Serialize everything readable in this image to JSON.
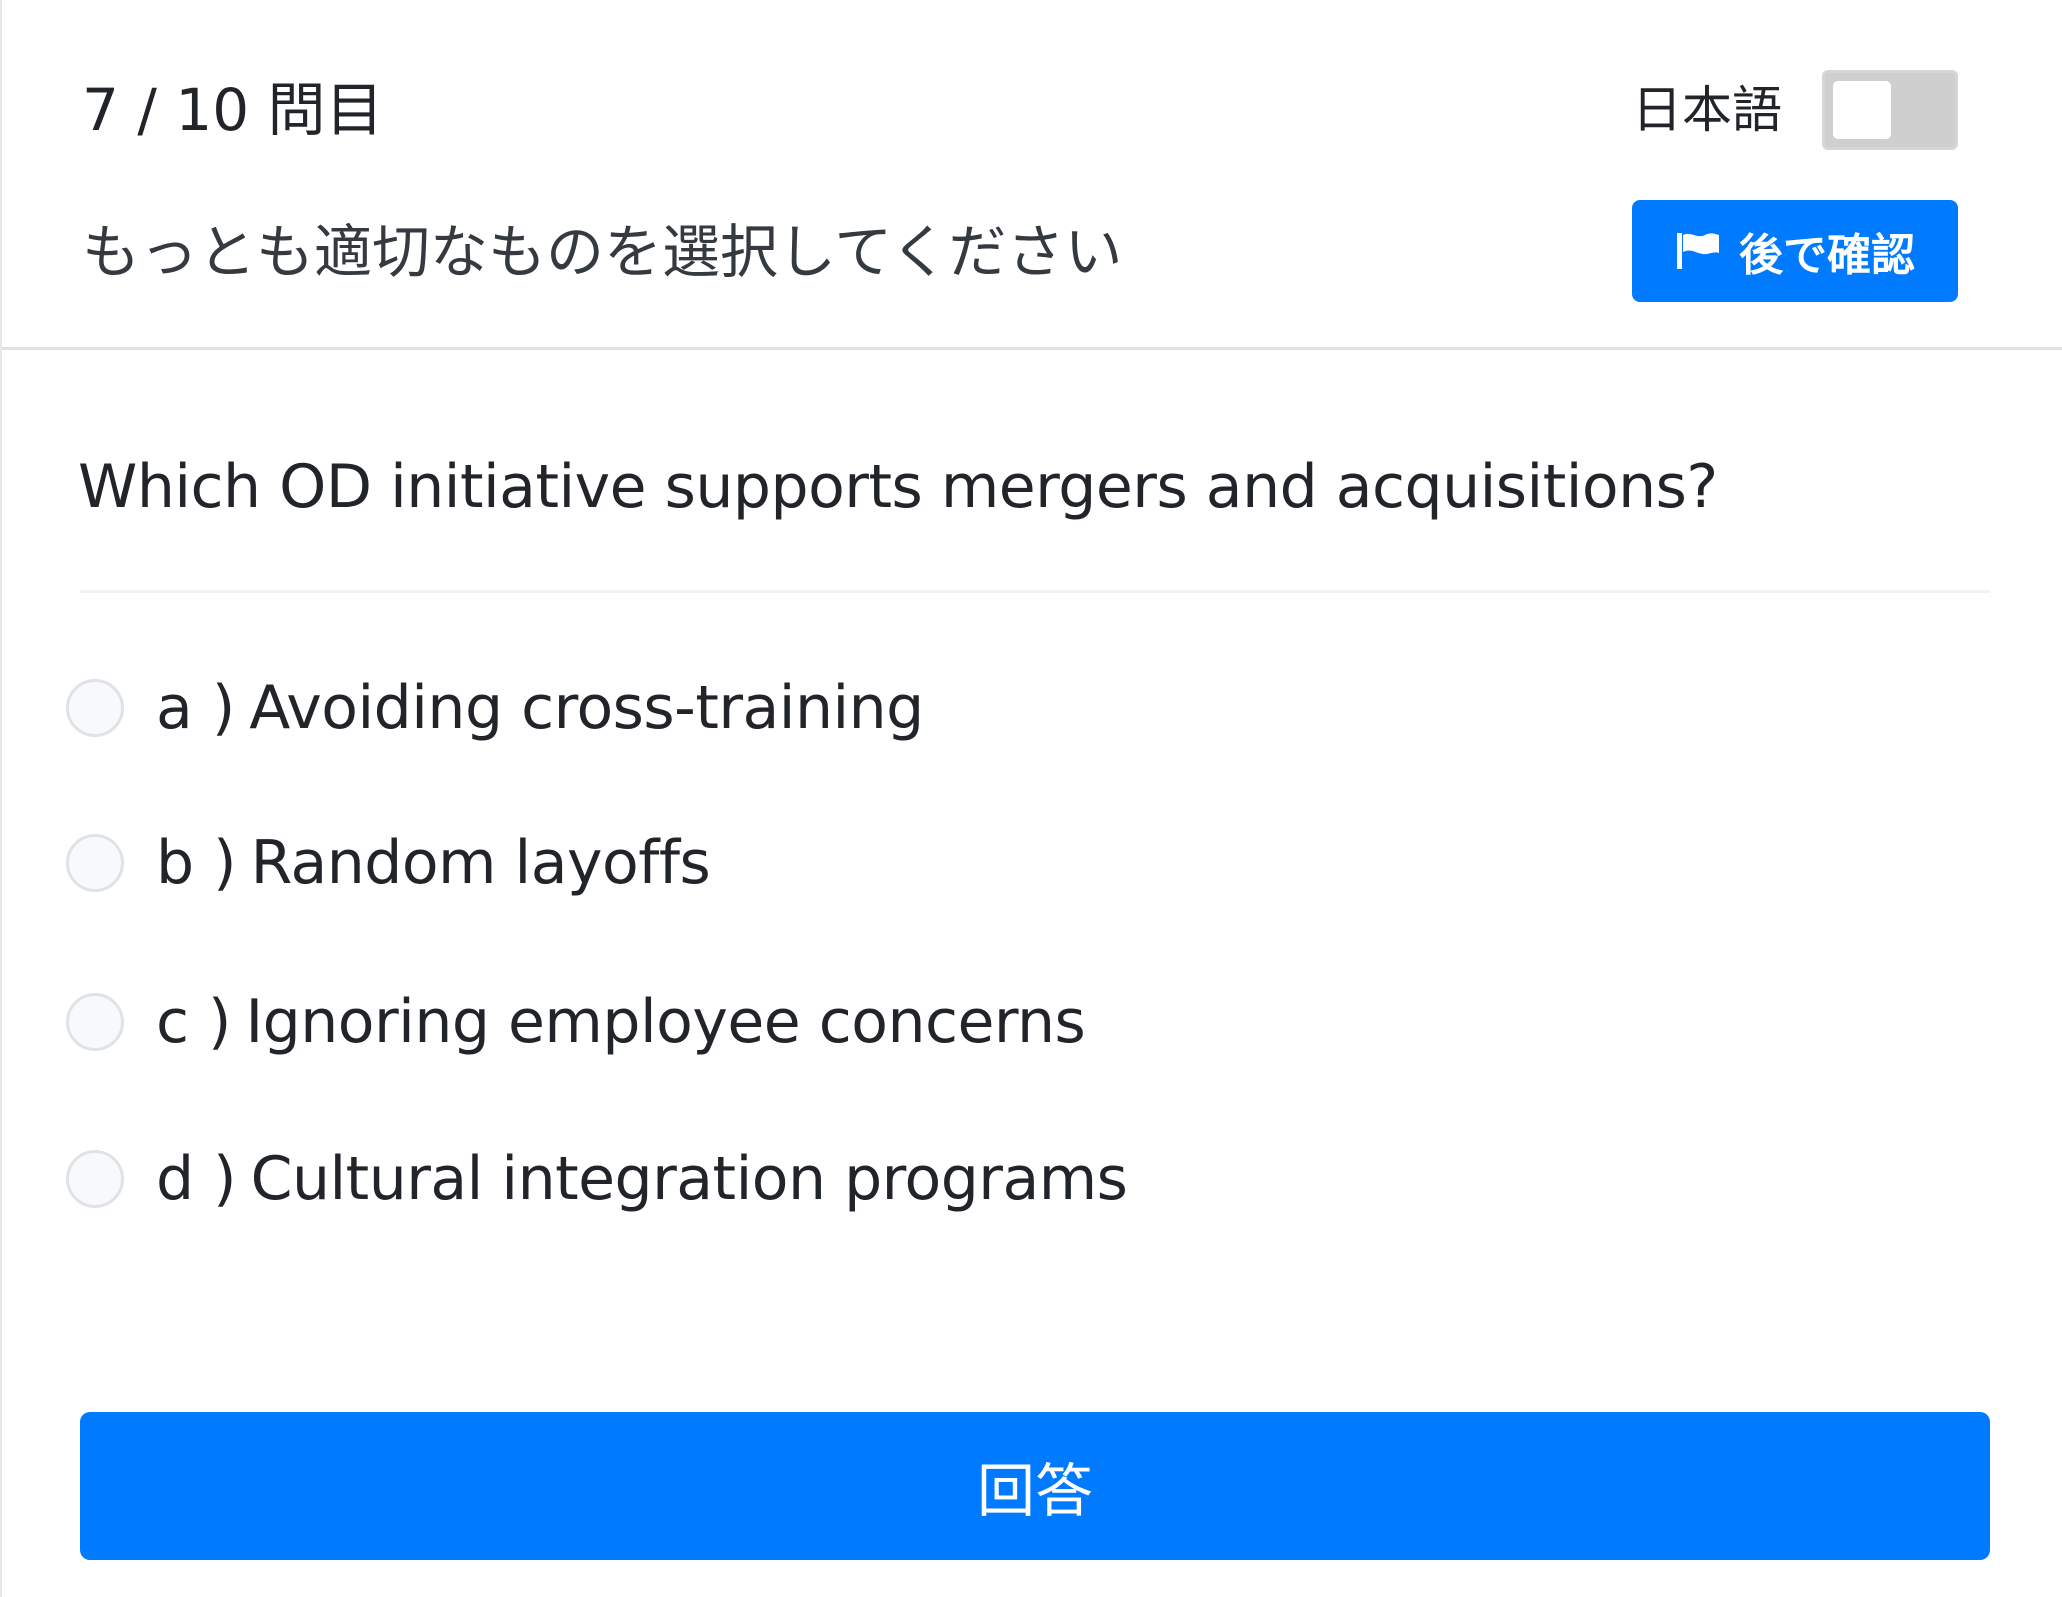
{
  "header": {
    "progress": "7 / 10 問目",
    "language_label": "日本語",
    "language_toggle_on": false,
    "instruction": "もっとも適切なものを選択してください",
    "review_later_label": "後で確認"
  },
  "question": {
    "text": "Which OD initiative supports mergers and acquisitions?"
  },
  "options": [
    {
      "letter": "a )",
      "text": "Avoiding cross-training",
      "selected": false
    },
    {
      "letter": "b )",
      "text": "Random layoffs",
      "selected": false
    },
    {
      "letter": "c )",
      "text": "Ignoring employee concerns",
      "selected": false
    },
    {
      "letter": "d )",
      "text": "Cultural integration programs",
      "selected": false
    }
  ],
  "footer": {
    "answer_label": "回答"
  },
  "colors": {
    "primary": "#007bff",
    "toggle_off": "#cfcfcf"
  },
  "icons": {
    "review_later": "flag-icon"
  }
}
